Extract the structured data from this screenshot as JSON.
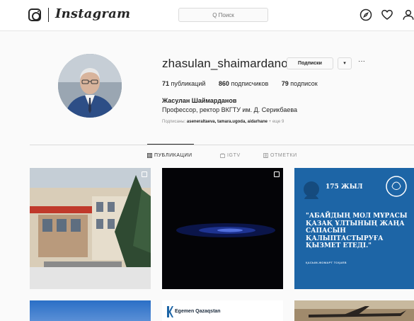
{
  "nav": {
    "brand": "Instagram",
    "search_placeholder": "Q Поиск",
    "icons": [
      "instagram-glyph-icon",
      "compass-icon",
      "heart-icon",
      "person-icon"
    ]
  },
  "profile": {
    "username": "zhasulan_shaimardanov",
    "follow_button": "Подписки",
    "dropdown_glyph": "▾",
    "more_glyph": "···",
    "stats": [
      {
        "value": "71",
        "label": "публикаций"
      },
      {
        "value": "860",
        "label": "подписчиков"
      },
      {
        "value": "79",
        "label": "подписок"
      }
    ],
    "full_name": "Жасулан Шаймарданов",
    "bio": "Профессор, ректор ВКГТУ им. Д. Серикбаева",
    "followed_by": {
      "prefix": "Подписаны:",
      "names": "aseneraltaeva, tamara.ugoda, aidarhane",
      "suffix": "+ еще 9"
    }
  },
  "tabs": [
    {
      "label": "ПУБЛИКАЦИИ",
      "active": true,
      "icon": "grid-icon"
    },
    {
      "label": "IGTV",
      "active": false,
      "icon": "tv-icon"
    },
    {
      "label": "ОТМЕТКИ",
      "active": false,
      "icon": "tag-icon"
    }
  ],
  "posts": {
    "post3": {
      "title": "175 ЖЫЛ",
      "quote": "\"АБАЙДЫҢ МОЛ МҰРАСЫ ҚАЗАҚ ҰЛТЫНЫҢ ЖАҢА САПАСЫН ҚАЛЫПТАСТЫРУҒА ҚЫЗМЕТ ЕТЕДІ.\"",
      "small": "ҚАСЫМ-ЖОМАРТ ТОҚАЕВ"
    },
    "post5": {
      "title": "Egemen Qazaqstan"
    }
  },
  "colors": {
    "post3_bg": "#1d65a6",
    "border": "#dbdbdb",
    "muted": "#8e8e8e",
    "text": "#262626"
  }
}
